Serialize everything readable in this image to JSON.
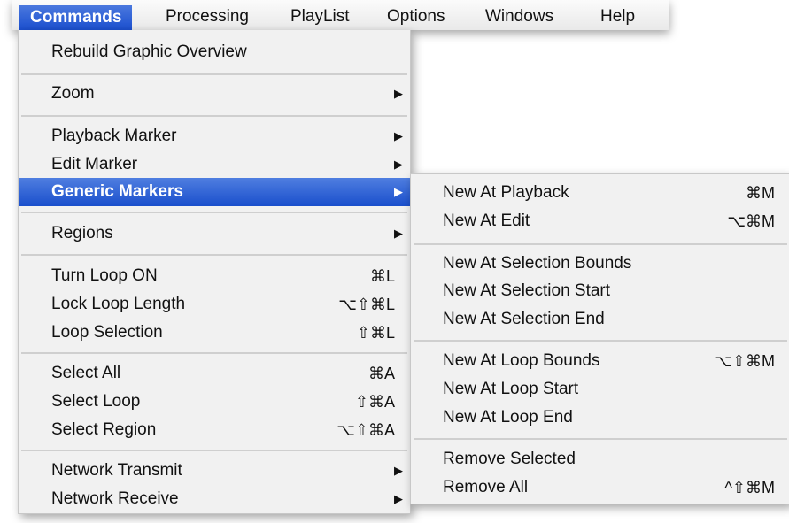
{
  "menubar": {
    "items": [
      {
        "label": "Commands"
      },
      {
        "label": "Processing"
      },
      {
        "label": "PlayList"
      },
      {
        "label": "Options"
      },
      {
        "label": "Windows"
      },
      {
        "label": "Help"
      }
    ]
  },
  "commands_menu": {
    "items": [
      {
        "label": "Rebuild Graphic Overview"
      },
      {
        "label": "Zoom"
      },
      {
        "label": "Playback Marker"
      },
      {
        "label": "Edit Marker"
      },
      {
        "label": "Generic Markers"
      },
      {
        "label": "Regions"
      },
      {
        "label": "Turn Loop ON",
        "shortcut": "⌘L"
      },
      {
        "label": "Lock Loop Length",
        "shortcut": "⌥⇧⌘L"
      },
      {
        "label": "Loop Selection",
        "shortcut": "⇧⌘L"
      },
      {
        "label": "Select All",
        "shortcut": "⌘A"
      },
      {
        "label": "Select Loop",
        "shortcut": "⇧⌘A"
      },
      {
        "label": "Select Region",
        "shortcut": "⌥⇧⌘A"
      },
      {
        "label": "Network Transmit"
      },
      {
        "label": "Network Receive"
      }
    ]
  },
  "generic_markers_menu": {
    "items": [
      {
        "label": "New At Playback",
        "shortcut": "⌘M"
      },
      {
        "label": "New At Edit",
        "shortcut": "⌥⌘M"
      },
      {
        "label": "New At Selection Bounds"
      },
      {
        "label": "New At Selection Start"
      },
      {
        "label": "New At Selection End"
      },
      {
        "label": "New At Loop Bounds",
        "shortcut": "⌥⇧⌘M"
      },
      {
        "label": "New At Loop Start"
      },
      {
        "label": "New At Loop End"
      },
      {
        "label": "Remove Selected"
      },
      {
        "label": "Remove All",
        "shortcut": "^⇧⌘M"
      }
    ]
  },
  "icons": {
    "submenu_arrow": "submenu-arrow-icon",
    "glyph": "▶"
  }
}
